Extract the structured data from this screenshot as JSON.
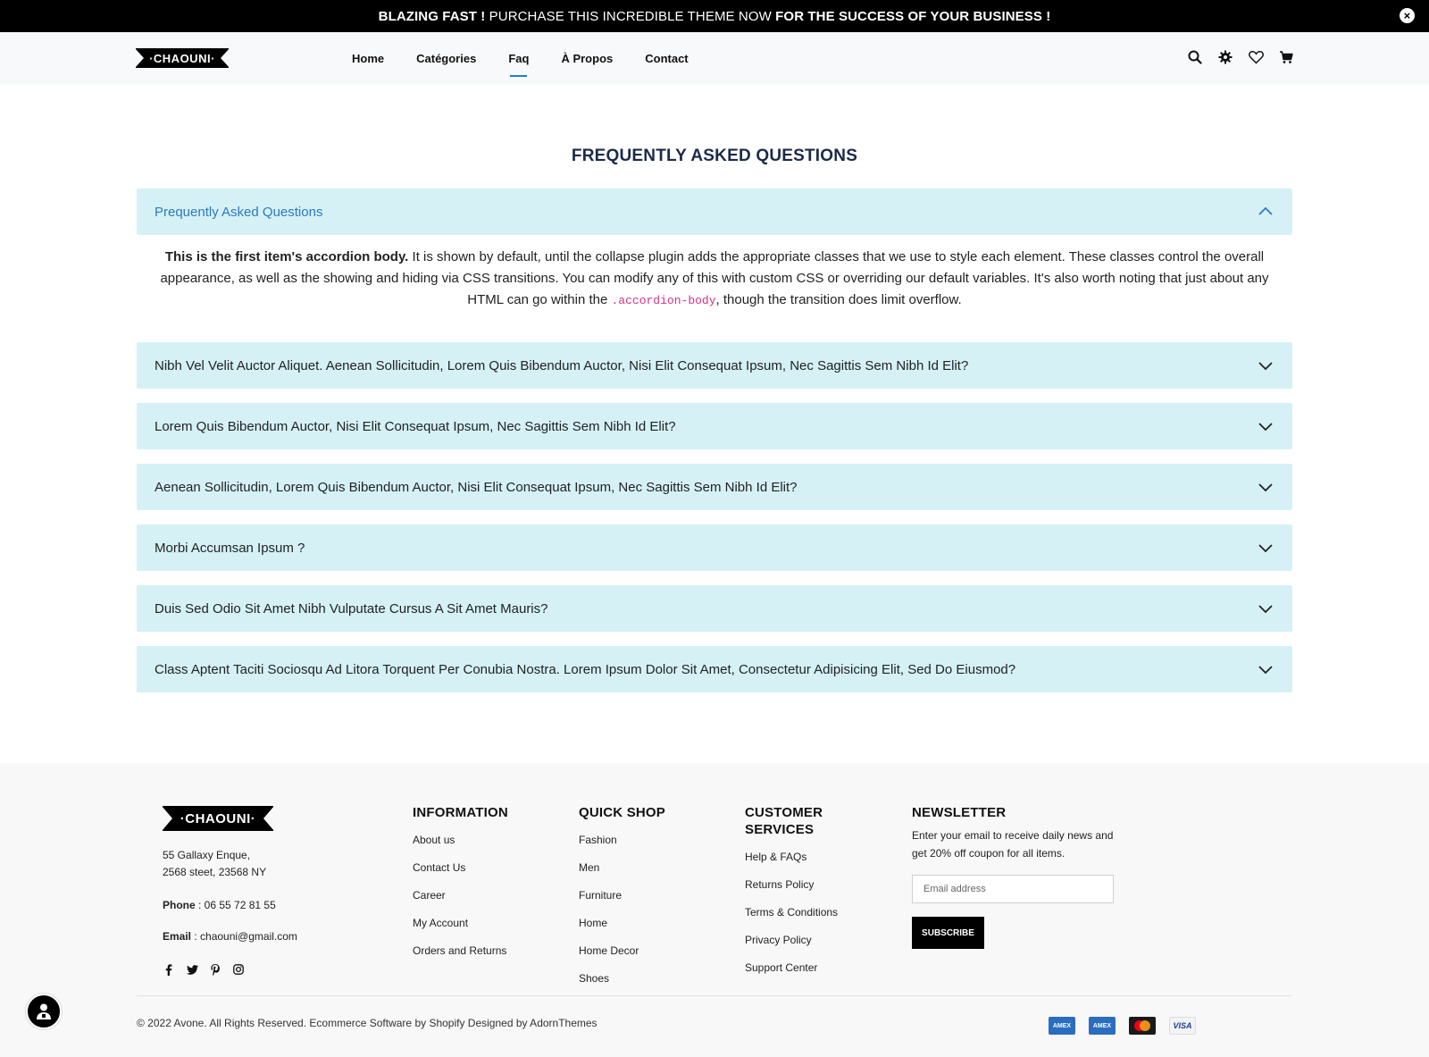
{
  "announcement": {
    "part1": "BLAZING FAST !",
    "part2": "PURCHASE THIS INCREDIBLE THEME NOW",
    "part3": "FOR THE SUCCESS OF YOUR BUSINESS !",
    "close_icon": "close-icon"
  },
  "header": {
    "logo_text": "·CHAOUNI·",
    "nav": [
      {
        "label": "Home"
      },
      {
        "label": "Catégories"
      },
      {
        "label": "Faq",
        "active": true
      },
      {
        "label": "À Propos"
      },
      {
        "label": "Contact"
      }
    ],
    "icons": [
      "search-icon",
      "gear-icon",
      "heart-icon",
      "cart-icon"
    ]
  },
  "faq": {
    "title": "FREQUENTLY ASKED QUESTIONS",
    "open_item": {
      "question": "Prequently Asked Questions",
      "body_bold": "This is the first item's accordion body.",
      "body_text": "It is shown by default, until the collapse plugin adds the appropriate classes that we use to style each element. These classes control the overall appearance, as well as the showing and hiding via CSS transitions. You can modify any of this with custom CSS or overriding our default variables. It's also worth noting that just about any HTML can go within the",
      "body_code": ".accordion-body",
      "body_tail": ", though the transition does limit overflow."
    },
    "items": [
      {
        "question": "Nibh Vel Velit Auctor Aliquet. Aenean Sollicitudin, Lorem Quis Bibendum Auctor, Nisi Elit Consequat Ipsum, Nec Sagittis Sem Nibh Id Elit?"
      },
      {
        "question": "Lorem Quis Bibendum Auctor, Nisi Elit Consequat Ipsum, Nec Sagittis Sem Nibh Id Elit?"
      },
      {
        "question": "Aenean Sollicitudin, Lorem Quis Bibendum Auctor, Nisi Elit Consequat Ipsum, Nec Sagittis Sem Nibh Id Elit?"
      },
      {
        "question": "Morbi Accumsan Ipsum ?"
      },
      {
        "question": "Duis Sed Odio Sit Amet Nibh Vulputate Cursus A Sit Amet Mauris?"
      },
      {
        "question": "Class Aptent Taciti Sociosqu Ad Litora Torquent Per Conubia Nostra. Lorem Ipsum Dolor Sit Amet, Consectetur Adipisicing Elit, Sed Do Eiusmod?"
      }
    ]
  },
  "footer": {
    "logo_text": "·CHAOUNI·",
    "address_line1": "55 Gallaxy Enque,",
    "address_line2": "2568 steet, 23568 NY",
    "phone_label": "Phone",
    "phone_value": " : 06 55 72 81 55",
    "email_label": "Email",
    "email_value": " : chaouni@gmail.com",
    "social_icons": [
      "facebook-icon",
      "twitter-icon",
      "pinterest-icon",
      "instagram-icon"
    ],
    "information": {
      "title": "INFORMATION",
      "links": [
        "About us",
        "Contact Us",
        "Career",
        "My Account",
        "Orders and Returns"
      ]
    },
    "quick_shop": {
      "title": "QUICK SHOP",
      "links": [
        "Fashion",
        "Men",
        "Furniture",
        "Home",
        "Home Decor",
        "Shoes"
      ]
    },
    "customer_services": {
      "title_line1": "CUSTOMER",
      "title_line2": "SERVICES",
      "links": [
        "Help & FAQs",
        "Returns Policy",
        "Terms & Conditions",
        "Privacy Policy",
        "Support Center"
      ]
    },
    "newsletter": {
      "title": "NEWSLETTER",
      "text": "Enter your email to receive daily news and get 20% off coupon for all items.",
      "placeholder": "Email address",
      "button": "SUBSCRIBE"
    },
    "copyright": "© 2022 Avone. All Rights Reserved. Ecommerce Software by Shopify Designed by AdornThemes",
    "payment_cards": [
      "AMEX",
      "AMEX",
      "MC",
      "VISA"
    ]
  },
  "colors": {
    "accordion_bg": "#d5f1f6",
    "accent": "#1a7fd6",
    "title": "#1c2a4a"
  }
}
